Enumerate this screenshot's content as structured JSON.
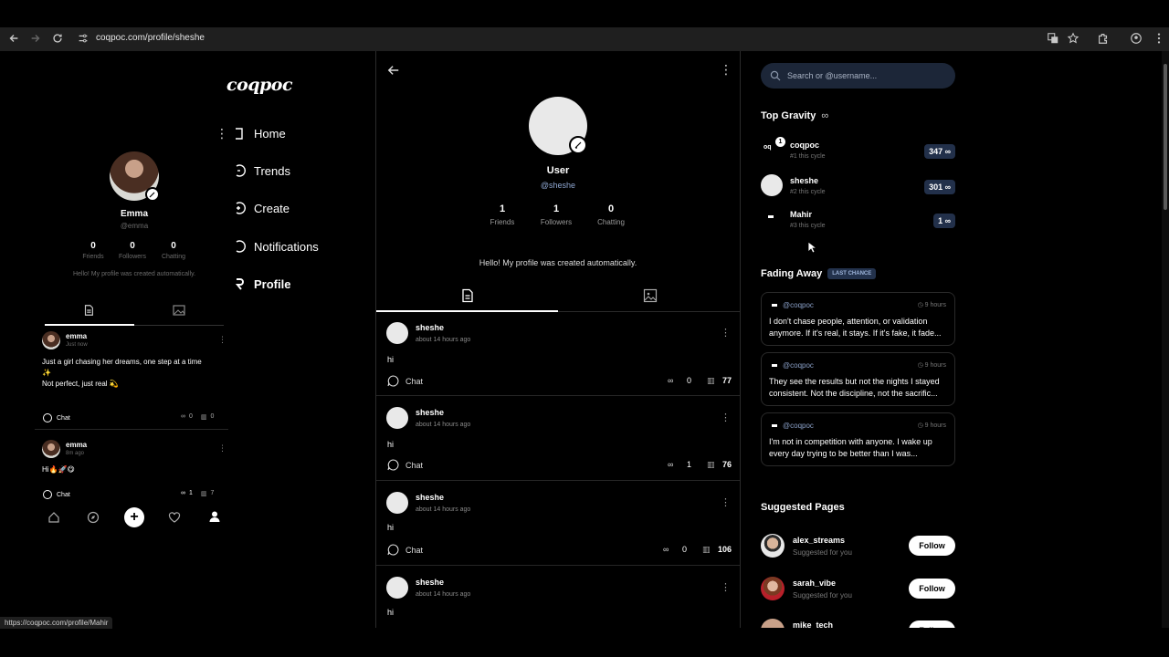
{
  "browser": {
    "url": "coqpoc.com/profile/sheshe",
    "status_url": "https://coqpoc.com/profile/Mahir"
  },
  "left_preview": {
    "logo": "coqpoc",
    "user": {
      "name": "Emma",
      "handle": "@emma",
      "stats": [
        {
          "value": "0",
          "label": "Friends"
        },
        {
          "value": "0",
          "label": "Followers"
        },
        {
          "value": "0",
          "label": "Chatting"
        }
      ],
      "bio": "Hello! My profile was created automatically."
    },
    "nav": [
      {
        "label": "Home",
        "icon": "home-icon"
      },
      {
        "label": "Trends",
        "icon": "trends-icon"
      },
      {
        "label": "Create",
        "icon": "create-icon"
      },
      {
        "label": "Notifications",
        "icon": "notifications-icon"
      },
      {
        "label": "Profile",
        "icon": "profile-icon"
      }
    ],
    "posts": [
      {
        "author": "emma",
        "time": "Just now",
        "text_line1": "Just a girl chasing her dreams, one step at a time",
        "text_line2": "✨",
        "text_line3": "Not perfect, just real 💫",
        "chat": "Chat",
        "gravity": "0",
        "views": "0"
      },
      {
        "author": "emma",
        "time": "8m ago",
        "text_line1": "Hi🔥🚀😋",
        "chat": "Chat",
        "gravity": "1",
        "views": "7"
      }
    ]
  },
  "profile": {
    "name": "User",
    "handle": "@sheshe",
    "stats": [
      {
        "value": "1",
        "label": "Friends"
      },
      {
        "value": "1",
        "label": "Followers"
      },
      {
        "value": "0",
        "label": "Chatting"
      }
    ],
    "bio": "Hello! My profile was created automatically."
  },
  "feed": [
    {
      "author": "sheshe",
      "time": "about 14 hours ago",
      "text": "hi",
      "chat": "Chat",
      "gravity": "0",
      "views": "77"
    },
    {
      "author": "sheshe",
      "time": "about 14 hours ago",
      "text": "hi",
      "chat": "Chat",
      "gravity": "1",
      "views": "76"
    },
    {
      "author": "sheshe",
      "time": "about 14 hours ago",
      "text": "hi",
      "chat": "Chat",
      "gravity": "0",
      "views": "106"
    },
    {
      "author": "sheshe",
      "time": "about 14 hours ago",
      "text": "hi"
    }
  ],
  "sidebar": {
    "search_placeholder": "Search or @username...",
    "top_gravity_title": "Top Gravity",
    "top_gravity_symbol": "∞",
    "top_gravity": [
      {
        "name": "coqpoc",
        "sub": "#1 this cycle",
        "score": "347 ∞",
        "badge": "1"
      },
      {
        "name": "sheshe",
        "sub": "#2 this cycle",
        "score": "301 ∞"
      },
      {
        "name": "Mahir",
        "sub": "#3 this cycle",
        "score": "1 ∞"
      }
    ],
    "fading_title": "Fading Away",
    "fading_badge": "LAST CHANCE",
    "fading": [
      {
        "handle": "@coqpoc",
        "time": "9 hours",
        "text": "I don't chase people, attention, or validation anymore. If it's real, it stays. If it's fake, it fade..."
      },
      {
        "handle": "@coqpoc",
        "time": "9 hours",
        "text": "They see the results but not the nights I stayed consistent. Not the discipline, not the sacrific..."
      },
      {
        "handle": "@coqpoc",
        "time": "9 hours",
        "text": "I'm not in competition with anyone. I wake up every day trying to be better than I was..."
      }
    ],
    "suggested_title": "Suggested Pages",
    "suggested": [
      {
        "name": "alex_streams",
        "sub": "Suggested for you",
        "button": "Follow"
      },
      {
        "name": "sarah_vibe",
        "sub": "Suggested for you",
        "button": "Follow"
      },
      {
        "name": "mike_tech",
        "sub": "",
        "button": "Follow"
      }
    ]
  }
}
